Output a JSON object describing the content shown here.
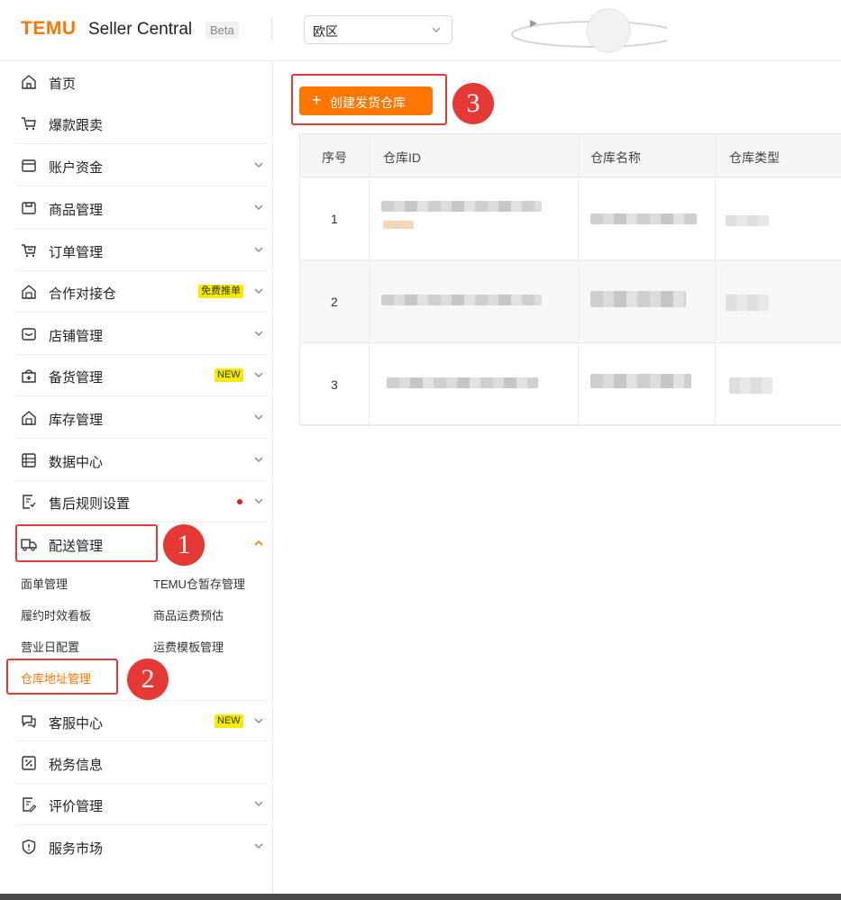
{
  "header": {
    "logo": "TEMU",
    "brand": "Seller Central",
    "beta": "Beta",
    "region": "欧区"
  },
  "sidebar": {
    "items": [
      {
        "label": "首页",
        "icon": "home-icon"
      },
      {
        "label": "爆款跟卖",
        "icon": "cart-follow-icon"
      },
      {
        "label": "账户资金",
        "icon": "wallet-icon"
      },
      {
        "label": "商品管理",
        "icon": "product-icon"
      },
      {
        "label": "订单管理",
        "icon": "order-icon"
      },
      {
        "label": "合作对接仓",
        "icon": "warehouse-icon",
        "badge": "免费推单"
      },
      {
        "label": "店铺管理",
        "icon": "store-icon"
      },
      {
        "label": "备货管理",
        "icon": "stock-icon",
        "badge": "NEW"
      },
      {
        "label": "库存管理",
        "icon": "inventory-icon"
      },
      {
        "label": "数据中心",
        "icon": "data-icon"
      },
      {
        "label": "售后规则设置",
        "icon": "aftersale-icon"
      },
      {
        "label": "配送管理",
        "icon": "delivery-icon"
      },
      {
        "label": "客服中心",
        "icon": "chat-icon",
        "badge": "NEW"
      },
      {
        "label": "税务信息",
        "icon": "tax-icon"
      },
      {
        "label": "评价管理",
        "icon": "review-icon"
      },
      {
        "label": "服务市场",
        "icon": "shield-icon"
      }
    ],
    "delivery_sub": [
      "面单管理",
      "TEMU仓暂存管理",
      "履约时效看板",
      "商品运费预估",
      "营业日配置",
      "运费模板管理",
      "仓库地址管理"
    ]
  },
  "callouts": [
    "1",
    "2",
    "3"
  ],
  "main": {
    "create_button": "创建发货仓库",
    "columns": [
      "序号",
      "仓库ID",
      "仓库名称",
      "仓库类型"
    ],
    "rows": [
      "1",
      "2",
      "3"
    ]
  },
  "colors": {
    "accent": "#fb7701",
    "callout": "#e53935",
    "badge": "#f7ea00"
  }
}
